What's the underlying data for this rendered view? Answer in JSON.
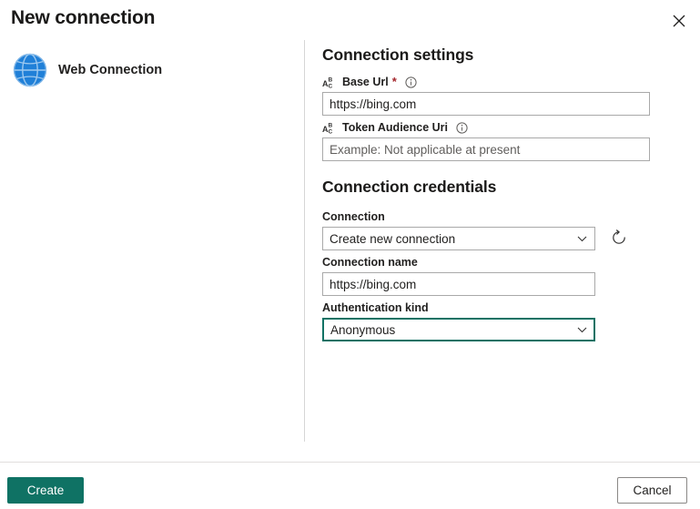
{
  "dialog": {
    "title": "New connection",
    "close_icon": "close-icon"
  },
  "connector_list": {
    "items": [
      {
        "label": "Web Connection",
        "icon": "globe-icon"
      }
    ]
  },
  "connection_settings": {
    "heading": "Connection settings",
    "fields": [
      {
        "label": "Base Url",
        "required_marker": "*",
        "type_icon": "abc-text-icon",
        "info_icon": "info-icon",
        "value": "https://bing.com",
        "placeholder": ""
      },
      {
        "label": "Token Audience Uri",
        "required_marker": "",
        "type_icon": "abc-text-icon",
        "info_icon": "info-icon",
        "value": "",
        "placeholder": "Example: Not applicable at present"
      }
    ]
  },
  "connection_credentials": {
    "heading": "Connection credentials",
    "connection": {
      "label": "Connection",
      "selected": "Create new connection",
      "chevron_icon": "chevron-down-icon",
      "refresh_icon": "refresh-icon"
    },
    "connection_name": {
      "label": "Connection name",
      "value": "https://bing.com",
      "placeholder": ""
    },
    "authentication_kind": {
      "label": "Authentication kind",
      "selected": "Anonymous",
      "chevron_icon": "chevron-down-icon"
    }
  },
  "footer": {
    "create_label": "Create",
    "cancel_label": "Cancel"
  },
  "colors": {
    "accent_teal": "#0f7264",
    "globe_blue": "#1f7ad4",
    "required_red": "#a4262c",
    "border_gray": "#a9a9a9",
    "divider_gray": "#d6d6d6"
  }
}
